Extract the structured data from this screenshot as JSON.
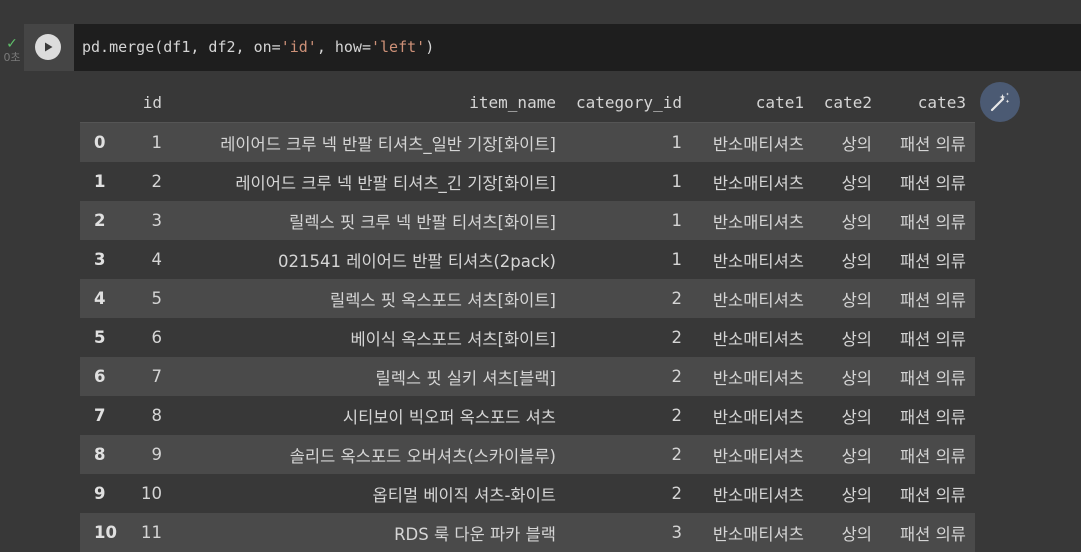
{
  "cell": {
    "status_icon": "check-icon",
    "exec_time": "0초",
    "code_parts": [
      "pd.merge(df1, df2, on=",
      "'id'",
      ", how=",
      "'left'",
      ")"
    ]
  },
  "table": {
    "columns": [
      "",
      "id",
      "item_name",
      "category_id",
      "cate1",
      "cate2",
      "cate3"
    ],
    "rows": [
      [
        "0",
        "1",
        "레이어드 크루 넥 반팔 티셔츠_일반 기장[화이트]",
        "1",
        "반소매티셔츠",
        "상의",
        "패션 의류"
      ],
      [
        "1",
        "2",
        "레이어드 크루 넥 반팔 티셔츠_긴 기장[화이트]",
        "1",
        "반소매티셔츠",
        "상의",
        "패션 의류"
      ],
      [
        "2",
        "3",
        "릴렉스 핏 크루 넥 반팔 티셔츠[화이트]",
        "1",
        "반소매티셔츠",
        "상의",
        "패션 의류"
      ],
      [
        "3",
        "4",
        "021541 레이어드 반팔 티셔츠(2pack)",
        "1",
        "반소매티셔츠",
        "상의",
        "패션 의류"
      ],
      [
        "4",
        "5",
        "릴렉스 핏 옥스포드 셔츠[화이트]",
        "2",
        "반소매티셔츠",
        "상의",
        "패션 의류"
      ],
      [
        "5",
        "6",
        "베이식 옥스포드 셔츠[화이트]",
        "2",
        "반소매티셔츠",
        "상의",
        "패션 의류"
      ],
      [
        "6",
        "7",
        "릴렉스 핏 실키 셔츠[블랙]",
        "2",
        "반소매티셔츠",
        "상의",
        "패션 의류"
      ],
      [
        "7",
        "8",
        "시티보이 빅오퍼 옥스포드 셔츠",
        "2",
        "반소매티셔츠",
        "상의",
        "패션 의류"
      ],
      [
        "8",
        "9",
        "솔리드 옥스포드 오버셔츠(스카이블루)",
        "2",
        "반소매티셔츠",
        "상의",
        "패션 의류"
      ],
      [
        "9",
        "10",
        "옵티멀 베이직 셔츠-화이트",
        "2",
        "반소매티셔츠",
        "상의",
        "패션 의류"
      ],
      [
        "10",
        "11",
        "RDS 룩 다운 파카 블랙",
        "3",
        "반소매티셔츠",
        "상의",
        "패션 의류"
      ]
    ]
  },
  "colors": {
    "background": "#383838",
    "code_background": "#1e1e1e",
    "string": "#ce9178",
    "success": "#5fbf6a",
    "row_stripe": "#4a4a4a"
  },
  "magic_button_icon": "magic-wand-icon",
  "run_button_icon": "play-icon"
}
